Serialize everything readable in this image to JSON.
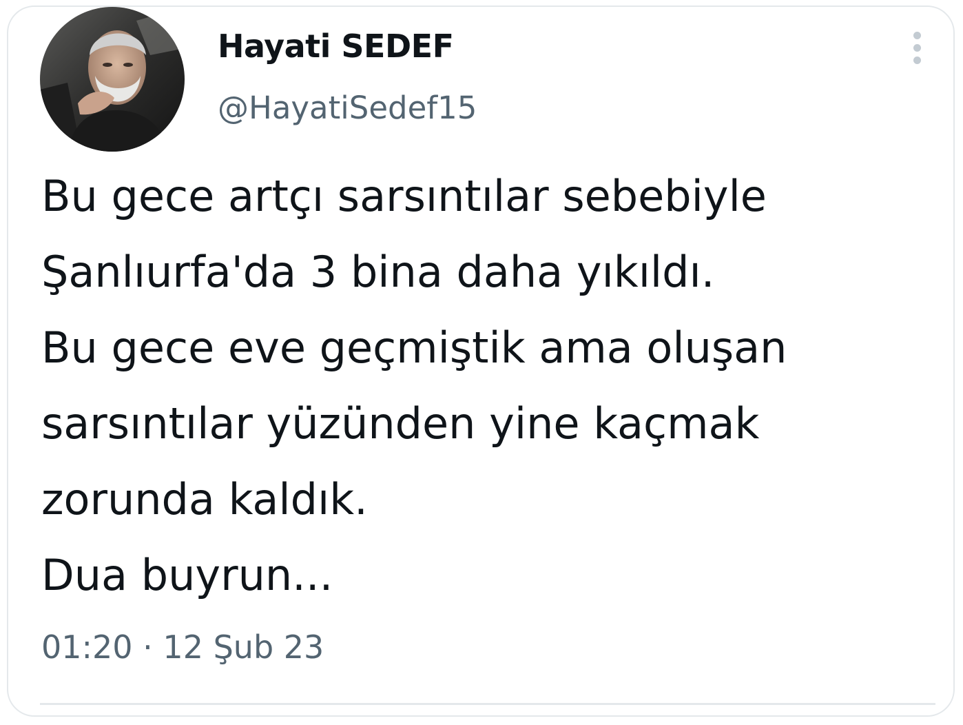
{
  "tweet": {
    "author": {
      "display_name": "Hayati SEDEF",
      "handle": "@HayatiSedef15"
    },
    "text_lines": [
      "Bu gece artçı sarsıntılar sebebiyle",
      "Şanlıurfa'da 3 bina daha yıkıldı.",
      "Bu gece eve geçmiştik ama oluşan",
      "sarsıntılar yüzünden yine kaçmak",
      "zorunda kaldık.",
      "Dua buyrun..."
    ],
    "timestamp": "01:20 · 12 Şub 23"
  },
  "icons": {
    "more": "more-vertical-icon"
  },
  "colors": {
    "text_primary": "#0f1419",
    "text_secondary": "#536471",
    "border": "#e4e8eb",
    "icon_muted": "#c3cbd2"
  }
}
